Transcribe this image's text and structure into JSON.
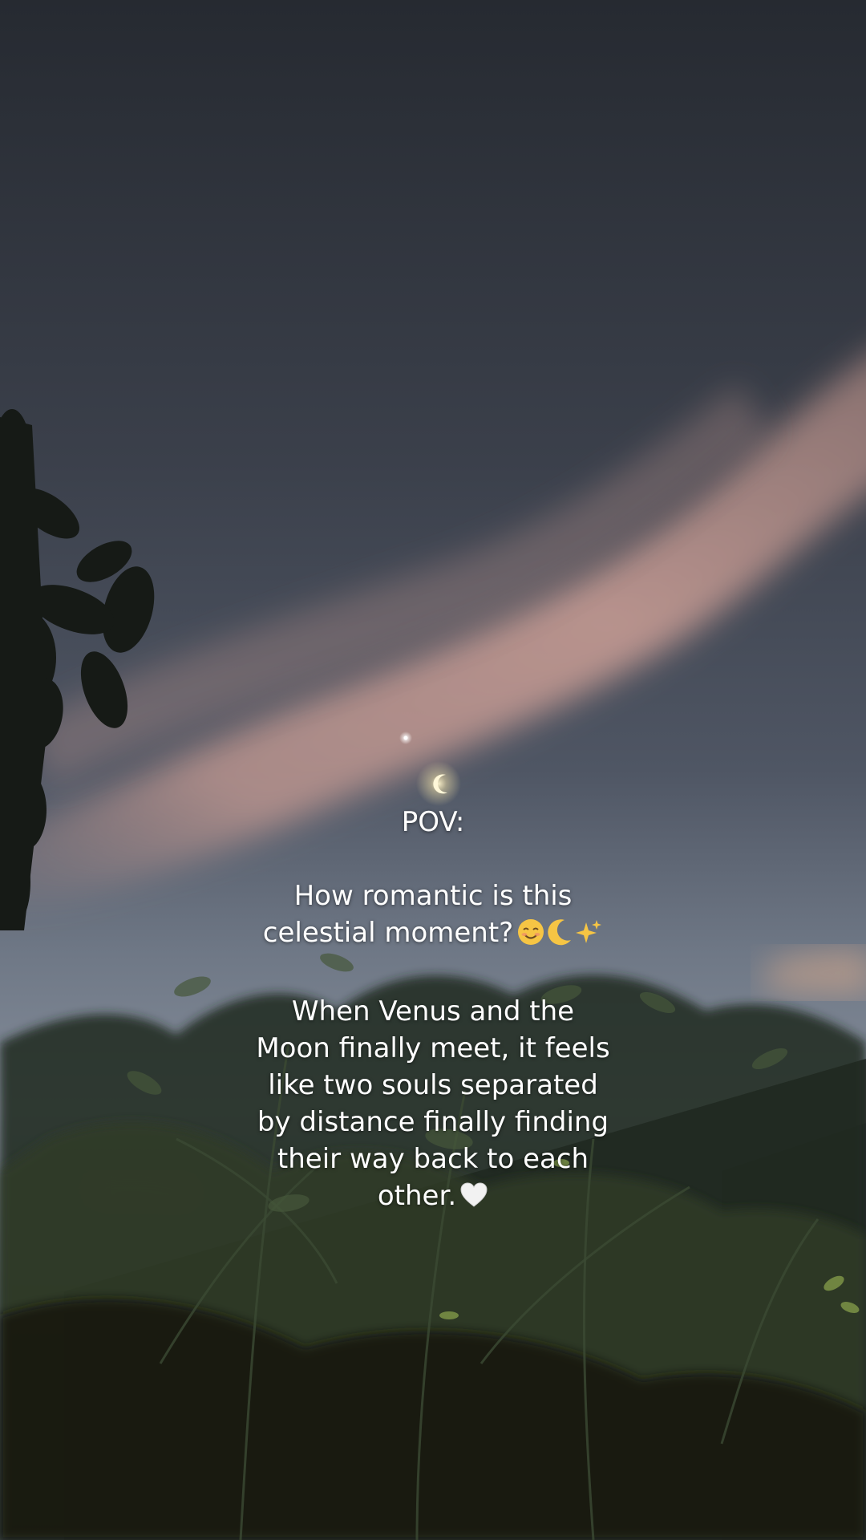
{
  "caption": {
    "heading": "POV:",
    "question_line1": "How romantic is this",
    "question_line2": "celestial moment?",
    "body_lines": [
      "When Venus and the",
      "Moon finally meet, it feels",
      "like two souls separated",
      "by distance finally finding",
      "their way back to each",
      "other."
    ]
  },
  "icons": {
    "question_emojis": [
      "smiling-face-icon",
      "crescent-moon-icon",
      "sparkles-icon"
    ],
    "closing_emoji": "white-heart-icon"
  },
  "colors": {
    "sky_top": "#2b3039",
    "sky_mid": "#4b5363",
    "sky_low": "#8a93a3",
    "cloud_pink": "#c99a96",
    "foliage": "#1c2418",
    "text": "#ffffff"
  }
}
